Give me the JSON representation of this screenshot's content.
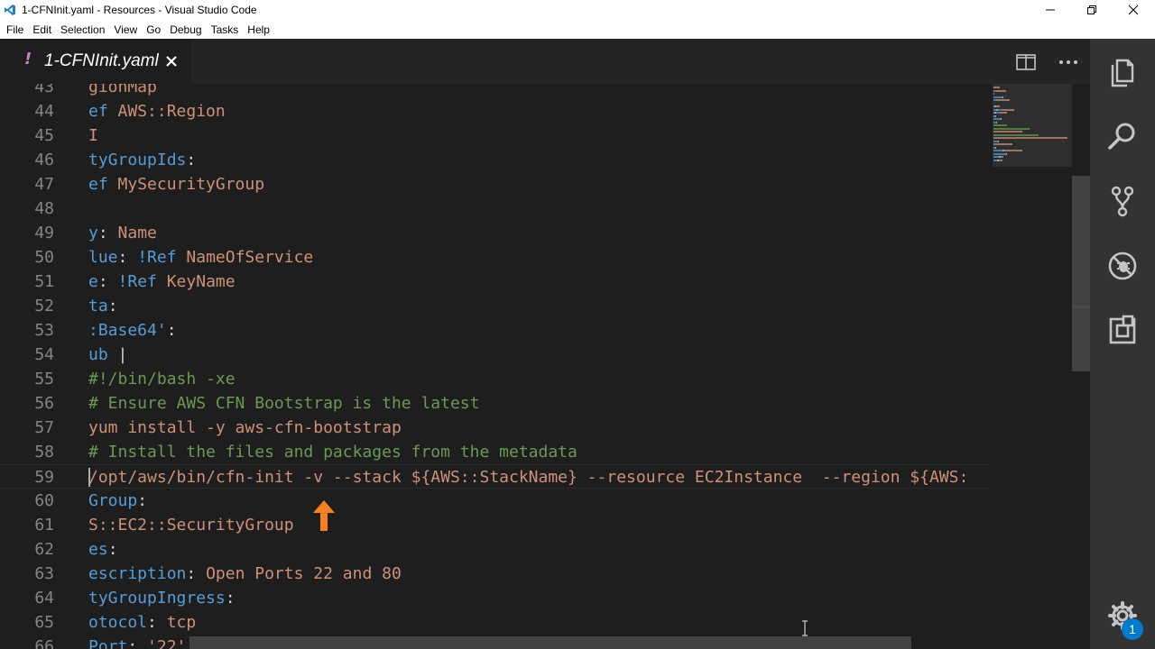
{
  "window": {
    "title": "1-CFNInit.yaml - Resources - Visual Studio Code",
    "icon": "vscode-icon"
  },
  "menu": [
    "File",
    "Edit",
    "Selection",
    "View",
    "Go",
    "Debug",
    "Tasks",
    "Help"
  ],
  "tab": {
    "modified_marker": "!",
    "label": "1-CFNInit.yaml",
    "close_icon": "close-icon"
  },
  "editor_actions": [
    "split-editor-icon",
    "more-actions-icon"
  ],
  "code_lines": [
    {
      "n": "43",
      "tokens": [
        [
          "s",
          "gionMap"
        ]
      ]
    },
    {
      "n": "44",
      "tokens": [
        [
          "k",
          "ef "
        ],
        [
          "s",
          "AWS::Region"
        ]
      ]
    },
    {
      "n": "45",
      "tokens": [
        [
          "s",
          "I"
        ]
      ]
    },
    {
      "n": "46",
      "tokens": [
        [
          "k",
          "tyGroupIds"
        ],
        [
          "p",
          ":"
        ]
      ]
    },
    {
      "n": "47",
      "tokens": [
        [
          "k",
          "ef "
        ],
        [
          "s",
          "MySecurityGroup"
        ]
      ]
    },
    {
      "n": "48",
      "tokens": []
    },
    {
      "n": "49",
      "tokens": [
        [
          "k",
          "y"
        ],
        [
          "p",
          ": "
        ],
        [
          "s",
          "Name"
        ]
      ]
    },
    {
      "n": "50",
      "tokens": [
        [
          "k",
          "lue"
        ],
        [
          "p",
          ": "
        ],
        [
          "k",
          "!Ref "
        ],
        [
          "s",
          "NameOfService"
        ]
      ]
    },
    {
      "n": "51",
      "tokens": [
        [
          "k",
          "e"
        ],
        [
          "p",
          ": "
        ],
        [
          "k",
          "!Ref "
        ],
        [
          "s",
          "KeyName"
        ]
      ]
    },
    {
      "n": "52",
      "tokens": [
        [
          "k",
          "ta"
        ],
        [
          "p",
          ":"
        ]
      ]
    },
    {
      "n": "53",
      "tokens": [
        [
          "k",
          ":Base64'"
        ],
        [
          "p",
          ":"
        ]
      ]
    },
    {
      "n": "54",
      "tokens": [
        [
          "k",
          "ub "
        ],
        [
          "p",
          "|"
        ]
      ]
    },
    {
      "n": "55",
      "tokens": [
        [
          "c",
          "#!/bin/bash -xe"
        ]
      ]
    },
    {
      "n": "56",
      "tokens": [
        [
          "c",
          "# Ensure AWS CFN Bootstrap is the latest"
        ]
      ]
    },
    {
      "n": "57",
      "tokens": [
        [
          "s",
          "yum install -y aws-cfn-bootstrap"
        ]
      ]
    },
    {
      "n": "58",
      "tokens": [
        [
          "c",
          "# Install the files and packages from the metadata"
        ]
      ]
    },
    {
      "n": "59",
      "tokens": [
        [
          "s",
          "/opt/aws/bin/cfn-init -v --stack ${AWS::StackName} --resource EC2Instance  --region ${AWS:"
        ]
      ]
    },
    {
      "n": "60",
      "tokens": [
        [
          "k",
          "Group"
        ],
        [
          "p",
          ":"
        ]
      ]
    },
    {
      "n": "61",
      "tokens": [
        [
          "s",
          "S::EC2::SecurityGroup"
        ]
      ]
    },
    {
      "n": "62",
      "tokens": [
        [
          "k",
          "es"
        ],
        [
          "p",
          ":"
        ]
      ]
    },
    {
      "n": "63",
      "tokens": [
        [
          "k",
          "escription"
        ],
        [
          "p",
          ": "
        ],
        [
          "s",
          "Open Ports 22 and 80"
        ]
      ]
    },
    {
      "n": "64",
      "tokens": [
        [
          "k",
          "tyGroupIngress"
        ],
        [
          "p",
          ":"
        ]
      ]
    },
    {
      "n": "65",
      "tokens": [
        [
          "k",
          "otocol"
        ],
        [
          "p",
          ": "
        ],
        [
          "s",
          "tcp"
        ]
      ]
    },
    {
      "n": "66",
      "tokens": [
        [
          "k",
          "Port"
        ],
        [
          "p",
          ": "
        ],
        [
          "s",
          "'22'"
        ]
      ]
    }
  ],
  "current_line": "59",
  "annotation": {
    "arrow_color": "#f5801f"
  },
  "activity_bar": {
    "icons": [
      "explorer-icon",
      "search-icon",
      "source-control-icon",
      "debug-icon",
      "extensions-icon"
    ],
    "settings_icon": "gear-icon",
    "badge_count": "1"
  },
  "colors": {
    "keyword": "#569cd6",
    "string": "#ce9178",
    "comment": "#6a9955",
    "line_number": "#858585",
    "activity_bar": "#333333",
    "badge": "#007acc"
  }
}
